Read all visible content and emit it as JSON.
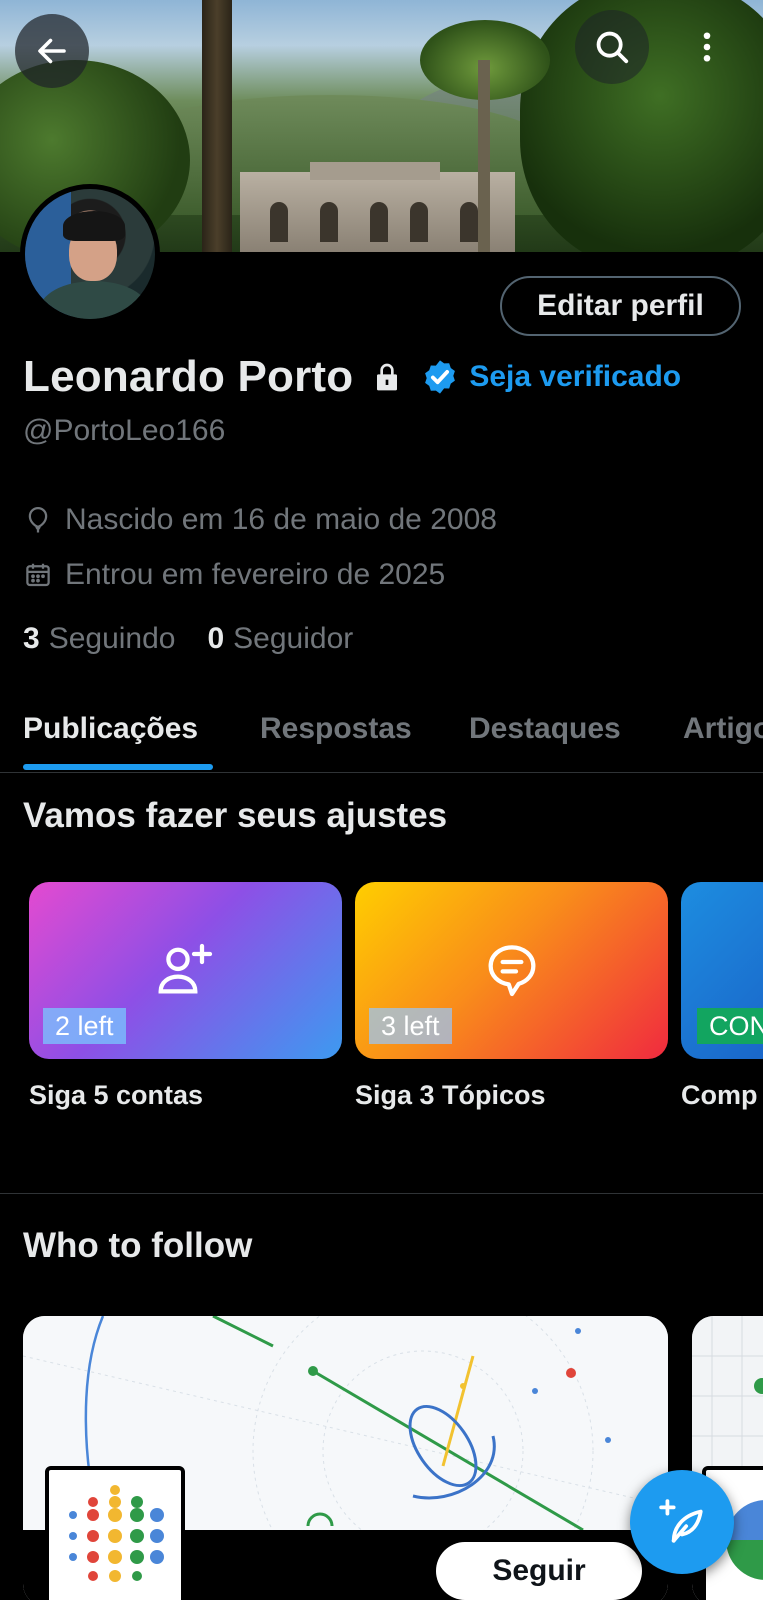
{
  "header": {
    "back_icon": "arrow-left-icon",
    "search_icon": "search-icon",
    "more_icon": "more-vertical-icon"
  },
  "profile": {
    "name": "Leonardo Porto",
    "handle": "@PortoLeo166",
    "edit_label": "Editar perfil",
    "get_verified_label": "Seja verificado",
    "birth": "Nascido em 16 de maio de 2008",
    "joined": "Entrou em fevereiro de 2025",
    "following_count": "3",
    "following_label": "Seguindo",
    "followers_count": "0",
    "followers_label": "Seguidor"
  },
  "tabs": [
    {
      "label": "Publicações",
      "active": true
    },
    {
      "label": "Respostas",
      "active": false
    },
    {
      "label": "Destaques",
      "active": false
    },
    {
      "label": "Artigos",
      "active": false
    }
  ],
  "setup": {
    "title": "Vamos fazer seus ajustes",
    "cards": [
      {
        "badge": "2 left",
        "label": "Siga 5 contas",
        "icon": "add-user-icon"
      },
      {
        "badge": "3 left",
        "label": "Siga 3 Tópicos",
        "icon": "topic-bubble-icon"
      },
      {
        "badge": "CON",
        "label": "Comp",
        "icon": ""
      }
    ]
  },
  "who_to_follow": {
    "title": "Who to follow",
    "follow_label": "Seguir"
  },
  "colors": {
    "accent": "#1d9bf0",
    "background": "#000000",
    "text_primary": "#e7e9ea",
    "text_secondary": "#71767b",
    "border": "#2f3336"
  },
  "fab_icon": "compose-post-icon"
}
